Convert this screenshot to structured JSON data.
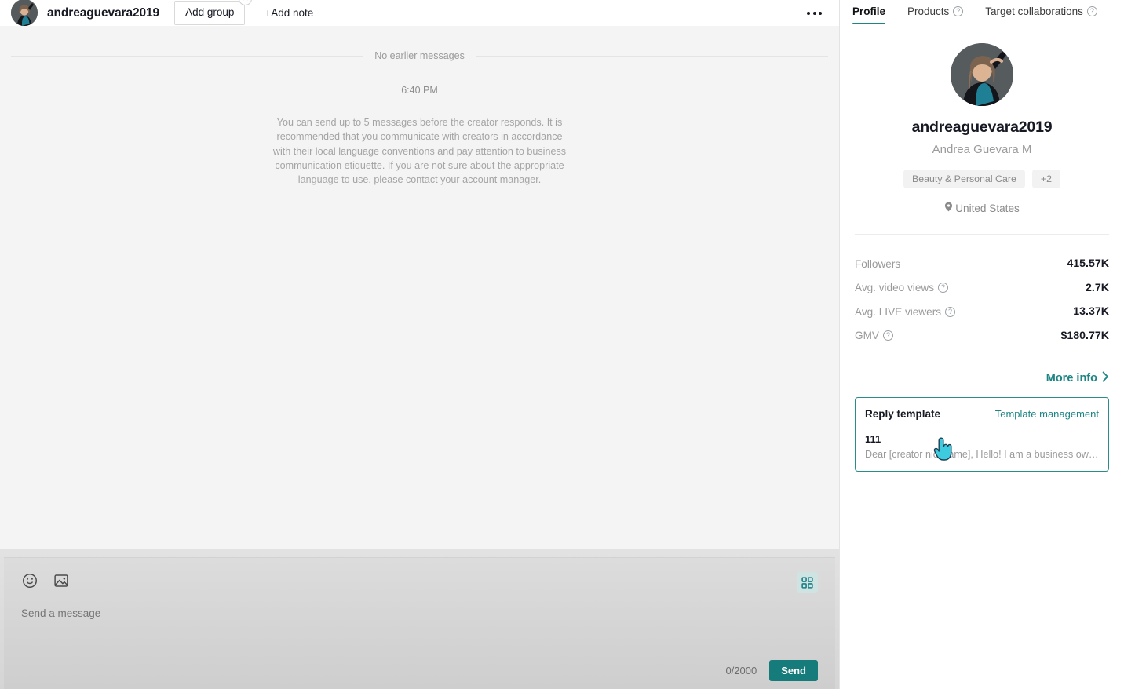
{
  "chat": {
    "header": {
      "username": "andreaguevara2019",
      "add_group_label": "Add group",
      "group_close_icon": "close-icon",
      "add_note_label": "+Add note",
      "more_menu_icon": "more-horizontal-icon",
      "avatar_icon": "avatar"
    },
    "divider_label": "No earlier messages",
    "timestamp": "6:40 PM",
    "notice": "You can send up to 5 messages before the creator responds. It is recommended that you communicate with creators in accordance with their local language conventions and pay attention to business communication etiquette. If you are not sure about the appropriate language to use, please contact your account manager.",
    "composer": {
      "emoji_icon": "emoji-smiley-icon",
      "image_icon": "image-icon",
      "grid_icon": "grid-apps-icon",
      "placeholder": "Send a message",
      "value": "",
      "char_count": "0/2000",
      "send_label": "Send"
    }
  },
  "profile": {
    "tabs": [
      {
        "label": "Profile",
        "active": true,
        "help": false
      },
      {
        "label": "Products",
        "active": false,
        "help": true
      },
      {
        "label": "Target collaborations",
        "active": false,
        "help": true
      }
    ],
    "avatar_icon": "avatar",
    "username": "andreaguevara2019",
    "real_name": "Andrea Guevara M",
    "tags": [
      "Beauty & Personal Care",
      "+2"
    ],
    "location_icon": "location-pin-icon",
    "location": "United States",
    "stats": [
      {
        "label": "Followers",
        "help": false,
        "value": "415.57K"
      },
      {
        "label": "Avg. video views",
        "help": true,
        "value": "2.7K"
      },
      {
        "label": "Avg. LIVE viewers",
        "help": true,
        "value": "13.37K"
      },
      {
        "label": "GMV",
        "help": true,
        "value": "$180.77K"
      }
    ],
    "more_info_label": "More info",
    "more_info_icon": "chevron-right-icon",
    "reply_template": {
      "title": "Reply template",
      "manage_label": "Template management",
      "item_name": "111",
      "item_preview": "Dear [creator nickname], Hello! I am a business ow…"
    }
  },
  "colors": {
    "accent": "#1e8585",
    "send_button": "#167b7b",
    "cursor": "#3ecbe0"
  }
}
